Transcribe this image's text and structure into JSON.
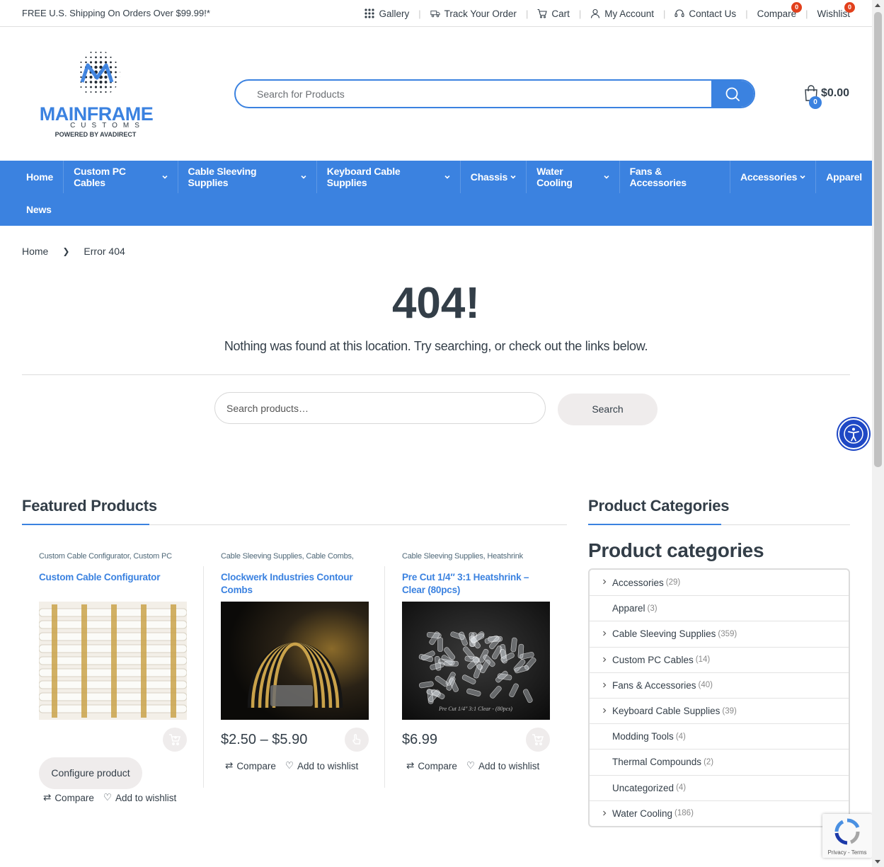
{
  "topbar": {
    "promo": "FREE U.S. Shipping On Orders Over $99.99!*",
    "links": [
      {
        "label": "Gallery",
        "icon": "grid-icon"
      },
      {
        "label": "Track Your Order",
        "icon": "truck-icon"
      },
      {
        "label": "Cart",
        "icon": "cart-icon"
      },
      {
        "label": "My Account",
        "icon": "user-icon"
      },
      {
        "label": "Contact Us",
        "icon": "headset-icon"
      },
      {
        "label": "Compare",
        "badge": "0"
      },
      {
        "label": "Wishlist",
        "badge": "0"
      }
    ]
  },
  "header": {
    "logo_top": "MAINFRAME",
    "logo_mid": "CUSTOMS",
    "logo_bottom": "POWERED BY AVADIRECT",
    "search_placeholder": "Search for Products",
    "cart_count": "0",
    "cart_total": "$0.00"
  },
  "nav": {
    "row1": [
      {
        "label": "Home",
        "dropdown": false
      },
      {
        "label": "Custom PC Cables",
        "dropdown": true
      },
      {
        "label": "Cable Sleeving Supplies",
        "dropdown": true
      },
      {
        "label": "Keyboard Cable Supplies",
        "dropdown": true
      },
      {
        "label": "Chassis",
        "dropdown": true
      },
      {
        "label": "Water Cooling",
        "dropdown": true
      },
      {
        "label": "Fans & Accessories",
        "dropdown": false
      },
      {
        "label": "Accessories",
        "dropdown": true
      },
      {
        "label": "Apparel",
        "dropdown": false
      }
    ],
    "row2": [
      {
        "label": "News",
        "dropdown": false
      }
    ]
  },
  "breadcrumb": {
    "home": "Home",
    "current": "Error 404"
  },
  "error": {
    "title": "404!",
    "message": "Nothing was found at this location. Try searching, or check out the links below.",
    "search_placeholder": "Search products…",
    "search_button": "Search"
  },
  "featured": {
    "title": "Featured Products",
    "products": [
      {
        "cats": "Custom Cable Configurator, Custom PC",
        "name": "Custom Cable Configurator",
        "price": "",
        "button": "Configure product",
        "compare": "Compare",
        "wishlist": "Add to wishlist"
      },
      {
        "cats": "Cable Sleeving Supplies, Cable Combs,",
        "name": "Clockwerk Industries Contour Combs",
        "price": "$2.50 – $5.90",
        "compare": "Compare",
        "wishlist": "Add to wishlist"
      },
      {
        "cats": "Cable Sleeving Supplies, Heatshrink",
        "name": "Pre Cut 1/4″ 3:1 Heatshrink – Clear (80pcs)",
        "price": "$6.99",
        "image_caption": "Pre Cut 1/4\" 3:1 Clear - (80pcs)",
        "compare": "Compare",
        "wishlist": "Add to wishlist"
      }
    ]
  },
  "categories": {
    "title": "Product Categories",
    "heading": "Product categories",
    "items": [
      {
        "name": "Accessories",
        "count": "(29)",
        "has_children": true
      },
      {
        "name": "Apparel",
        "count": "(3)",
        "has_children": false
      },
      {
        "name": "Cable Sleeving Supplies",
        "count": "(359)",
        "has_children": true
      },
      {
        "name": "Custom PC Cables",
        "count": "(14)",
        "has_children": true
      },
      {
        "name": "Fans & Accessories",
        "count": "(40)",
        "has_children": true
      },
      {
        "name": "Keyboard Cable Supplies",
        "count": "(39)",
        "has_children": true
      },
      {
        "name": "Modding Tools",
        "count": "(4)",
        "has_children": false
      },
      {
        "name": "Thermal Compounds",
        "count": "(2)",
        "has_children": false
      },
      {
        "name": "Uncategorized",
        "count": "(4)",
        "has_children": false
      },
      {
        "name": "Water Cooling",
        "count": "(186)",
        "has_children": true
      }
    ]
  },
  "recaptcha": {
    "privacy": "Privacy",
    "terms": "Terms"
  },
  "colors": {
    "accent": "#3b82e0",
    "text": "#333e48",
    "badge": "#e2401c"
  }
}
